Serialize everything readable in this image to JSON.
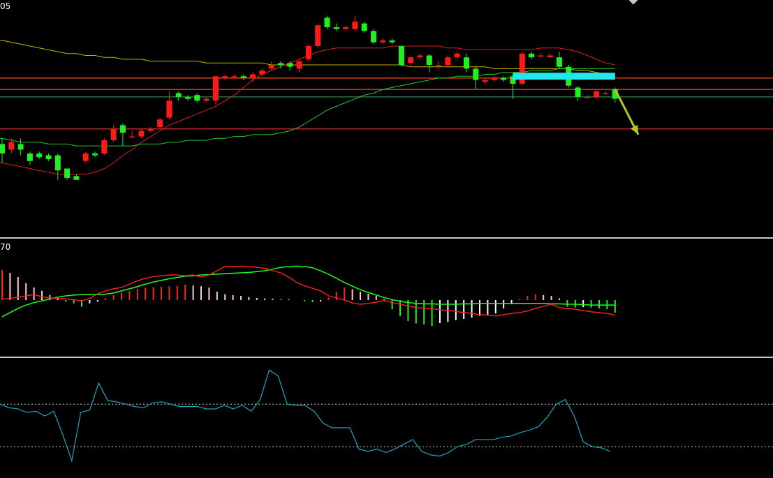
{
  "header": {
    "price_corner_label": "05",
    "macd_corner_label": "70"
  },
  "colors": {
    "background": "#000000",
    "bull_candle": "#ff1a1a",
    "bear_candle": "#22ee22",
    "ma_yellow": "#c8b400",
    "ma_red": "#dd2020",
    "ma_green": "#22cc22",
    "horizontal_orange": "#ff4422",
    "horizontal_red": "#ff3030",
    "horizontal_green": "#2a8a4a",
    "highlight_box": "#22e6ee",
    "arrow": "#b4c81e",
    "macd_dif": "#ff2020",
    "macd_dea": "#22ee22",
    "macd_hist_pos_rising": "#ff2020",
    "macd_hist_pos_falling": "#ffc8d8",
    "macd_hist_neg_falling": "#22ee22",
    "macd_hist_neg_rising": "#ffffff",
    "oscillator_line": "#1ea8c0",
    "divider": "#c8c8c8",
    "dotted_level": "#c8c8c8"
  },
  "chart_data": [
    {
      "type": "candlestick",
      "panel": "price",
      "ylim": [
        0,
        100
      ],
      "candles": [
        {
          "o": 28,
          "c": 23,
          "h": 31,
          "l": 18
        },
        {
          "o": 25,
          "c": 29,
          "h": 31,
          "l": 23
        },
        {
          "o": 28,
          "c": 25,
          "h": 31,
          "l": 22
        },
        {
          "o": 23,
          "c": 19,
          "h": 24,
          "l": 17
        },
        {
          "o": 23,
          "c": 21,
          "h": 24,
          "l": 20
        },
        {
          "o": 22,
          "c": 20,
          "h": 23,
          "l": 19
        },
        {
          "o": 22,
          "c": 14,
          "h": 23,
          "l": 9
        },
        {
          "o": 15,
          "c": 10,
          "h": 15,
          "l": 9
        },
        {
          "o": 11,
          "c": 9,
          "h": 12,
          "l": 9
        },
        {
          "o": 19,
          "c": 23,
          "h": 24,
          "l": 18
        },
        {
          "o": 23,
          "c": 22,
          "h": 24,
          "l": 21
        },
        {
          "o": 23,
          "c": 30,
          "h": 31,
          "l": 22
        },
        {
          "o": 30,
          "c": 36,
          "h": 38,
          "l": 29
        },
        {
          "o": 38,
          "c": 34,
          "h": 39,
          "l": 27
        },
        {
          "o": 32,
          "c": 32,
          "h": 35,
          "l": 31
        },
        {
          "o": 32,
          "c": 35,
          "h": 36,
          "l": 31
        },
        {
          "o": 35,
          "c": 36,
          "h": 37,
          "l": 34
        },
        {
          "o": 37,
          "c": 41,
          "h": 42,
          "l": 36
        },
        {
          "o": 42,
          "c": 51,
          "h": 56,
          "l": 41
        },
        {
          "o": 55,
          "c": 53,
          "h": 56,
          "l": 51
        },
        {
          "o": 53,
          "c": 52,
          "h": 54,
          "l": 51
        },
        {
          "o": 54,
          "c": 51,
          "h": 55,
          "l": 50
        },
        {
          "o": 51,
          "c": 52,
          "h": 53,
          "l": 50
        },
        {
          "o": 51,
          "c": 64,
          "h": 64,
          "l": 49
        },
        {
          "o": 63,
          "c": 64,
          "h": 65,
          "l": 62
        },
        {
          "o": 64,
          "c": 64,
          "h": 65,
          "l": 63
        },
        {
          "o": 64,
          "c": 63,
          "h": 65,
          "l": 62
        },
        {
          "o": 63,
          "c": 65,
          "h": 66,
          "l": 61
        },
        {
          "o": 65,
          "c": 67,
          "h": 68,
          "l": 64
        },
        {
          "o": 68,
          "c": 70,
          "h": 72,
          "l": 67
        },
        {
          "o": 71,
          "c": 70,
          "h": 72,
          "l": 68
        },
        {
          "o": 71,
          "c": 69,
          "h": 72,
          "l": 67
        },
        {
          "o": 68,
          "c": 72,
          "h": 73,
          "l": 66
        },
        {
          "o": 73,
          "c": 80,
          "h": 81,
          "l": 72
        },
        {
          "o": 80,
          "c": 91,
          "h": 92,
          "l": 79
        },
        {
          "o": 95,
          "c": 90,
          "h": 96,
          "l": 89
        },
        {
          "o": 90,
          "c": 89,
          "h": 92,
          "l": 88
        },
        {
          "o": 89,
          "c": 90,
          "h": 91,
          "l": 88
        },
        {
          "o": 89,
          "c": 93,
          "h": 96,
          "l": 88
        },
        {
          "o": 92,
          "c": 88,
          "h": 93,
          "l": 87
        },
        {
          "o": 88,
          "c": 82,
          "h": 89,
          "l": 81
        },
        {
          "o": 82,
          "c": 83,
          "h": 84,
          "l": 81
        },
        {
          "o": 83,
          "c": 82,
          "h": 84,
          "l": 81
        },
        {
          "o": 80,
          "c": 70,
          "h": 80,
          "l": 69
        },
        {
          "o": 71,
          "c": 74,
          "h": 75,
          "l": 70
        },
        {
          "o": 74,
          "c": 75,
          "h": 76,
          "l": 73
        },
        {
          "o": 75,
          "c": 70,
          "h": 76,
          "l": 66
        },
        {
          "o": 70,
          "c": 70,
          "h": 72,
          "l": 68
        },
        {
          "o": 70,
          "c": 74,
          "h": 75,
          "l": 69
        },
        {
          "o": 74,
          "c": 76,
          "h": 77,
          "l": 73
        },
        {
          "o": 74,
          "c": 68,
          "h": 76,
          "l": 66
        },
        {
          "o": 68,
          "c": 62,
          "h": 69,
          "l": 57
        },
        {
          "o": 61,
          "c": 62,
          "h": 63,
          "l": 60
        },
        {
          "o": 62,
          "c": 63,
          "h": 64,
          "l": 61
        },
        {
          "o": 63,
          "c": 62,
          "h": 64,
          "l": 61
        },
        {
          "o": 64,
          "c": 60,
          "h": 65,
          "l": 52
        },
        {
          "o": 60,
          "c": 76,
          "h": 77,
          "l": 59
        },
        {
          "o": 76,
          "c": 74,
          "h": 77,
          "l": 73
        },
        {
          "o": 75,
          "c": 75,
          "h": 76,
          "l": 74
        },
        {
          "o": 74,
          "c": 75,
          "h": 76,
          "l": 74
        },
        {
          "o": 74,
          "c": 69,
          "h": 77,
          "l": 68
        },
        {
          "o": 69,
          "c": 59,
          "h": 70,
          "l": 58
        },
        {
          "o": 58,
          "c": 53,
          "h": 59,
          "l": 51
        },
        {
          "o": 53,
          "c": 53,
          "h": 54,
          "l": 52
        },
        {
          "o": 53,
          "c": 56,
          "h": 57,
          "l": 52
        },
        {
          "o": 55,
          "c": 55,
          "h": 56,
          "l": 54
        },
        {
          "o": 57,
          "c": 52,
          "h": 58,
          "l": 50
        }
      ],
      "moving_averages": [
        {
          "color": "#c8b400",
          "values": [
            83,
            82,
            81,
            80,
            79,
            78,
            77,
            76,
            76,
            75,
            75,
            74,
            74,
            73,
            73,
            73,
            72,
            72,
            72,
            72,
            72,
            72,
            71,
            71,
            71,
            71,
            71,
            71,
            71,
            70,
            70,
            70,
            70,
            70,
            70,
            70,
            70,
            70,
            70,
            70,
            70,
            70,
            70,
            70,
            69,
            69,
            69,
            69,
            69,
            69,
            69,
            69,
            69,
            68,
            68,
            68,
            68,
            68,
            68,
            68,
            68,
            68,
            67,
            67,
            66,
            65,
            64
          ]
        },
        {
          "color": "#dd2020",
          "values": [
            18,
            17,
            16,
            15,
            14,
            13,
            12,
            12,
            12,
            12,
            13,
            15,
            18,
            22,
            25,
            29,
            32,
            35,
            38,
            40,
            42,
            44,
            46,
            48,
            51,
            54,
            58,
            62,
            65,
            67,
            69,
            71,
            73,
            75,
            77,
            78,
            79,
            79,
            79,
            79,
            79,
            79,
            80,
            80,
            80,
            80,
            80,
            80,
            79,
            79,
            78,
            78,
            78,
            78,
            78,
            78,
            78,
            78,
            79,
            79,
            79,
            78,
            77,
            75,
            73,
            71,
            70
          ]
        },
        {
          "color": "#22cc22",
          "values": [
            31,
            30,
            29,
            29,
            29,
            28,
            28,
            28,
            27,
            27,
            27,
            27,
            27,
            27,
            27,
            28,
            28,
            28,
            29,
            29,
            30,
            30,
            30,
            31,
            31,
            32,
            32,
            33,
            33,
            33,
            34,
            35,
            37,
            40,
            43,
            46,
            48,
            50,
            52,
            54,
            55,
            57,
            58,
            59,
            60,
            61,
            62,
            63,
            63,
            64,
            64,
            64,
            65,
            65,
            66,
            66,
            66,
            67,
            67,
            67,
            68,
            68,
            68,
            68,
            68,
            68,
            68
          ]
        }
      ],
      "horizontal_levels": [
        {
          "value": 63,
          "color": "#ff4422"
        },
        {
          "value": 57,
          "color": "#ff4422"
        },
        {
          "value": 53,
          "color": "#2a8a4a"
        },
        {
          "value": 36,
          "color": "#ff3030"
        }
      ],
      "annotations": [
        {
          "kind": "highlight_box",
          "from_index": 55,
          "to_index": 66,
          "value": 64,
          "color": "#22e6ee"
        },
        {
          "kind": "arrow",
          "from_index": 66,
          "from_value": 57,
          "to_index": 68.5,
          "to_value": 33,
          "color": "#b4c81e"
        }
      ]
    },
    {
      "type": "macd",
      "panel": "macd",
      "ylim": [
        -1,
        1
      ],
      "histogram": [
        0.72,
        0.65,
        0.55,
        0.4,
        0.3,
        0.22,
        0.12,
        0.04,
        -0.04,
        -0.08,
        -0.16,
        -0.08,
        -0.04,
        0.05,
        0.12,
        0.18,
        0.22,
        0.27,
        0.3,
        0.31,
        0.32,
        0.33,
        0.34,
        0.37,
        0.35,
        0.33,
        0.3,
        0.2,
        0.14,
        0.12,
        0.1,
        0.07,
        0.05,
        0.04,
        0.03,
        0.03,
        0.02,
        0.0,
        -0.03,
        -0.05,
        -0.03,
        0.06,
        0.2,
        0.3,
        0.26,
        0.2,
        0.15,
        0.1,
        0.02,
        -0.22,
        -0.38,
        -0.5,
        -0.56,
        -0.58,
        -0.62,
        -0.55,
        -0.52,
        -0.48,
        -0.45,
        -0.42,
        -0.38,
        -0.35,
        -0.32,
        -0.2,
        -0.1,
        0.02,
        0.1,
        0.14,
        0.12,
        0.1,
        0.04,
        -0.16,
        -0.18,
        -0.17,
        -0.18,
        -0.2,
        -0.22,
        -0.3
      ],
      "dif": [
        0.02,
        0.04,
        0.07,
        0.1,
        0.13,
        0.08,
        0.05,
        0.04,
        0.03,
        0.01,
        -0.02,
        0.04,
        0.15,
        0.22,
        0.27,
        0.3,
        0.38,
        0.46,
        0.52,
        0.56,
        0.58,
        0.6,
        0.6,
        0.58,
        0.6,
        0.55,
        0.6,
        0.7,
        0.8,
        0.8,
        0.81,
        0.8,
        0.78,
        0.76,
        0.7,
        0.65,
        0.55,
        0.42,
        0.34,
        0.28,
        0.22,
        0.1,
        0.05,
        0.0,
        -0.07,
        -0.1,
        -0.08,
        -0.05,
        -0.01,
        -0.06,
        -0.1,
        -0.14,
        -0.18,
        -0.19,
        -0.21,
        -0.23,
        -0.25,
        -0.27,
        -0.3,
        -0.32,
        -0.35,
        -0.36,
        -0.38,
        -0.35,
        -0.32,
        -0.3,
        -0.26,
        -0.2,
        -0.15,
        -0.1,
        -0.18,
        -0.2,
        -0.22,
        -0.25,
        -0.28,
        -0.3,
        -0.32,
        -0.36
      ],
      "dea": [
        -0.4,
        -0.3,
        -0.2,
        -0.12,
        -0.06,
        -0.02,
        0.03,
        0.07,
        0.1,
        0.12,
        0.13,
        0.13,
        0.13,
        0.14,
        0.17,
        0.22,
        0.27,
        0.32,
        0.38,
        0.43,
        0.47,
        0.51,
        0.54,
        0.57,
        0.58,
        0.6,
        0.61,
        0.62,
        0.63,
        0.64,
        0.65,
        0.66,
        0.68,
        0.7,
        0.74,
        0.78,
        0.8,
        0.81,
        0.8,
        0.77,
        0.7,
        0.62,
        0.52,
        0.42,
        0.33,
        0.25,
        0.18,
        0.12,
        0.06,
        0.01,
        -0.03,
        -0.06,
        -0.08,
        -0.09,
        -0.09,
        -0.1,
        -0.1,
        -0.1,
        -0.09,
        -0.09,
        -0.08,
        -0.08,
        -0.08,
        -0.08,
        -0.08,
        -0.08,
        -0.08,
        -0.08,
        -0.08,
        -0.09,
        -0.09,
        -0.1,
        -0.1,
        -0.11,
        -0.12,
        -0.12,
        -0.12,
        -0.12
      ]
    },
    {
      "type": "line",
      "panel": "oscillator",
      "ylim": [
        0,
        100
      ],
      "reference_levels": [
        62,
        26
      ],
      "values": [
        62,
        59,
        58,
        55,
        56,
        52,
        56,
        36,
        14,
        55,
        57,
        80,
        65,
        64,
        62,
        60,
        59,
        63,
        64,
        62,
        60,
        60,
        60,
        58,
        58,
        61,
        58,
        61,
        56,
        66,
        91,
        86,
        62,
        61,
        61,
        56,
        46,
        42,
        42,
        42,
        24,
        22,
        24,
        21,
        24,
        28,
        32,
        22,
        19,
        18,
        21,
        26,
        28,
        32,
        32,
        32,
        34,
        35,
        38,
        40,
        43,
        51,
        62,
        66,
        52,
        30,
        26,
        25,
        22
      ]
    }
  ]
}
